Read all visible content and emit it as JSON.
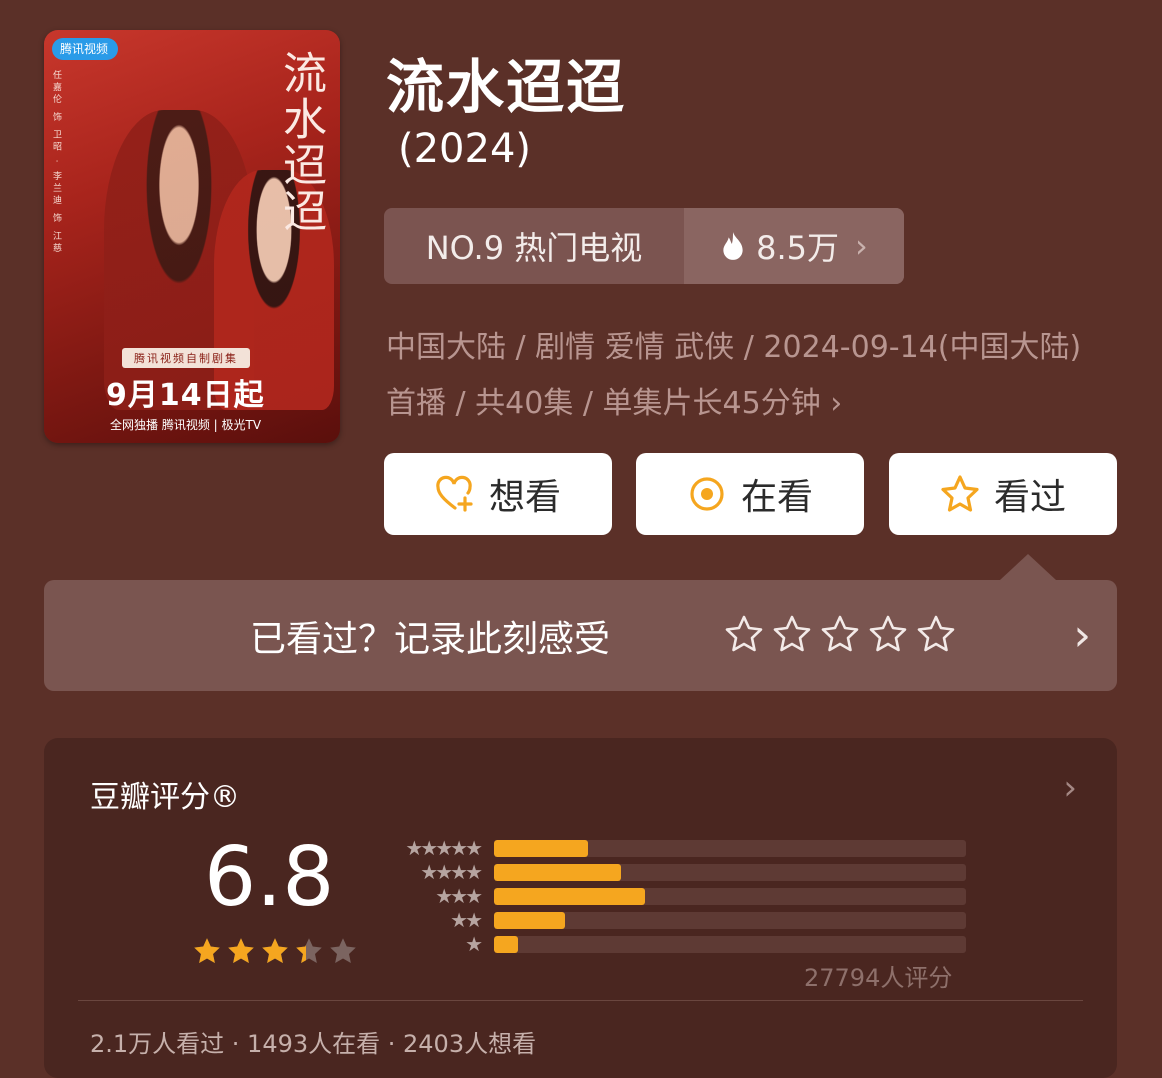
{
  "poster": {
    "badge": "腾讯视频",
    "calligraphy": "流水迢迢",
    "cast": "任嘉伦 饰 卫昭 · 李兰迪 饰 江慈",
    "tagline": "腾讯视频自制剧集",
    "date": "9月14日起",
    "footer": "全网独播 腾讯视频 | 极光TV"
  },
  "title": "流水迢迢",
  "year": "(2024)",
  "rank": {
    "label": "NO.9 热门电视",
    "heat": "8.5万",
    "chevron": "›"
  },
  "meta": {
    "text": "中国大陆 / 剧情 爱情 武侠 / 2024-09-14(中国大陆) 首播 / 共40集 / 单集片长45分钟",
    "chevron": "›"
  },
  "buttons": {
    "want": "想看",
    "watching": "在看",
    "watched": "看过"
  },
  "record": {
    "prompt": "已看过？记录此刻感受",
    "arrow": "›",
    "star_count": 5
  },
  "rating": {
    "label": "豆瓣评分®",
    "chevron": "›",
    "score": "6.8",
    "stars_value": 3.4,
    "distribution": [
      {
        "stars": "★★★★★",
        "fraction": 0.2
      },
      {
        "stars": "★★★★",
        "fraction": 0.27
      },
      {
        "stars": "★★★",
        "fraction": 0.32
      },
      {
        "stars": "★★",
        "fraction": 0.15
      },
      {
        "stars": "★",
        "fraction": 0.05
      }
    ],
    "count": "27794人评分",
    "summary": "2.1万人看过 · 1493人在看 · 2403人想看"
  },
  "colors": {
    "accent": "#f5a61f",
    "background": "#5b3028"
  }
}
